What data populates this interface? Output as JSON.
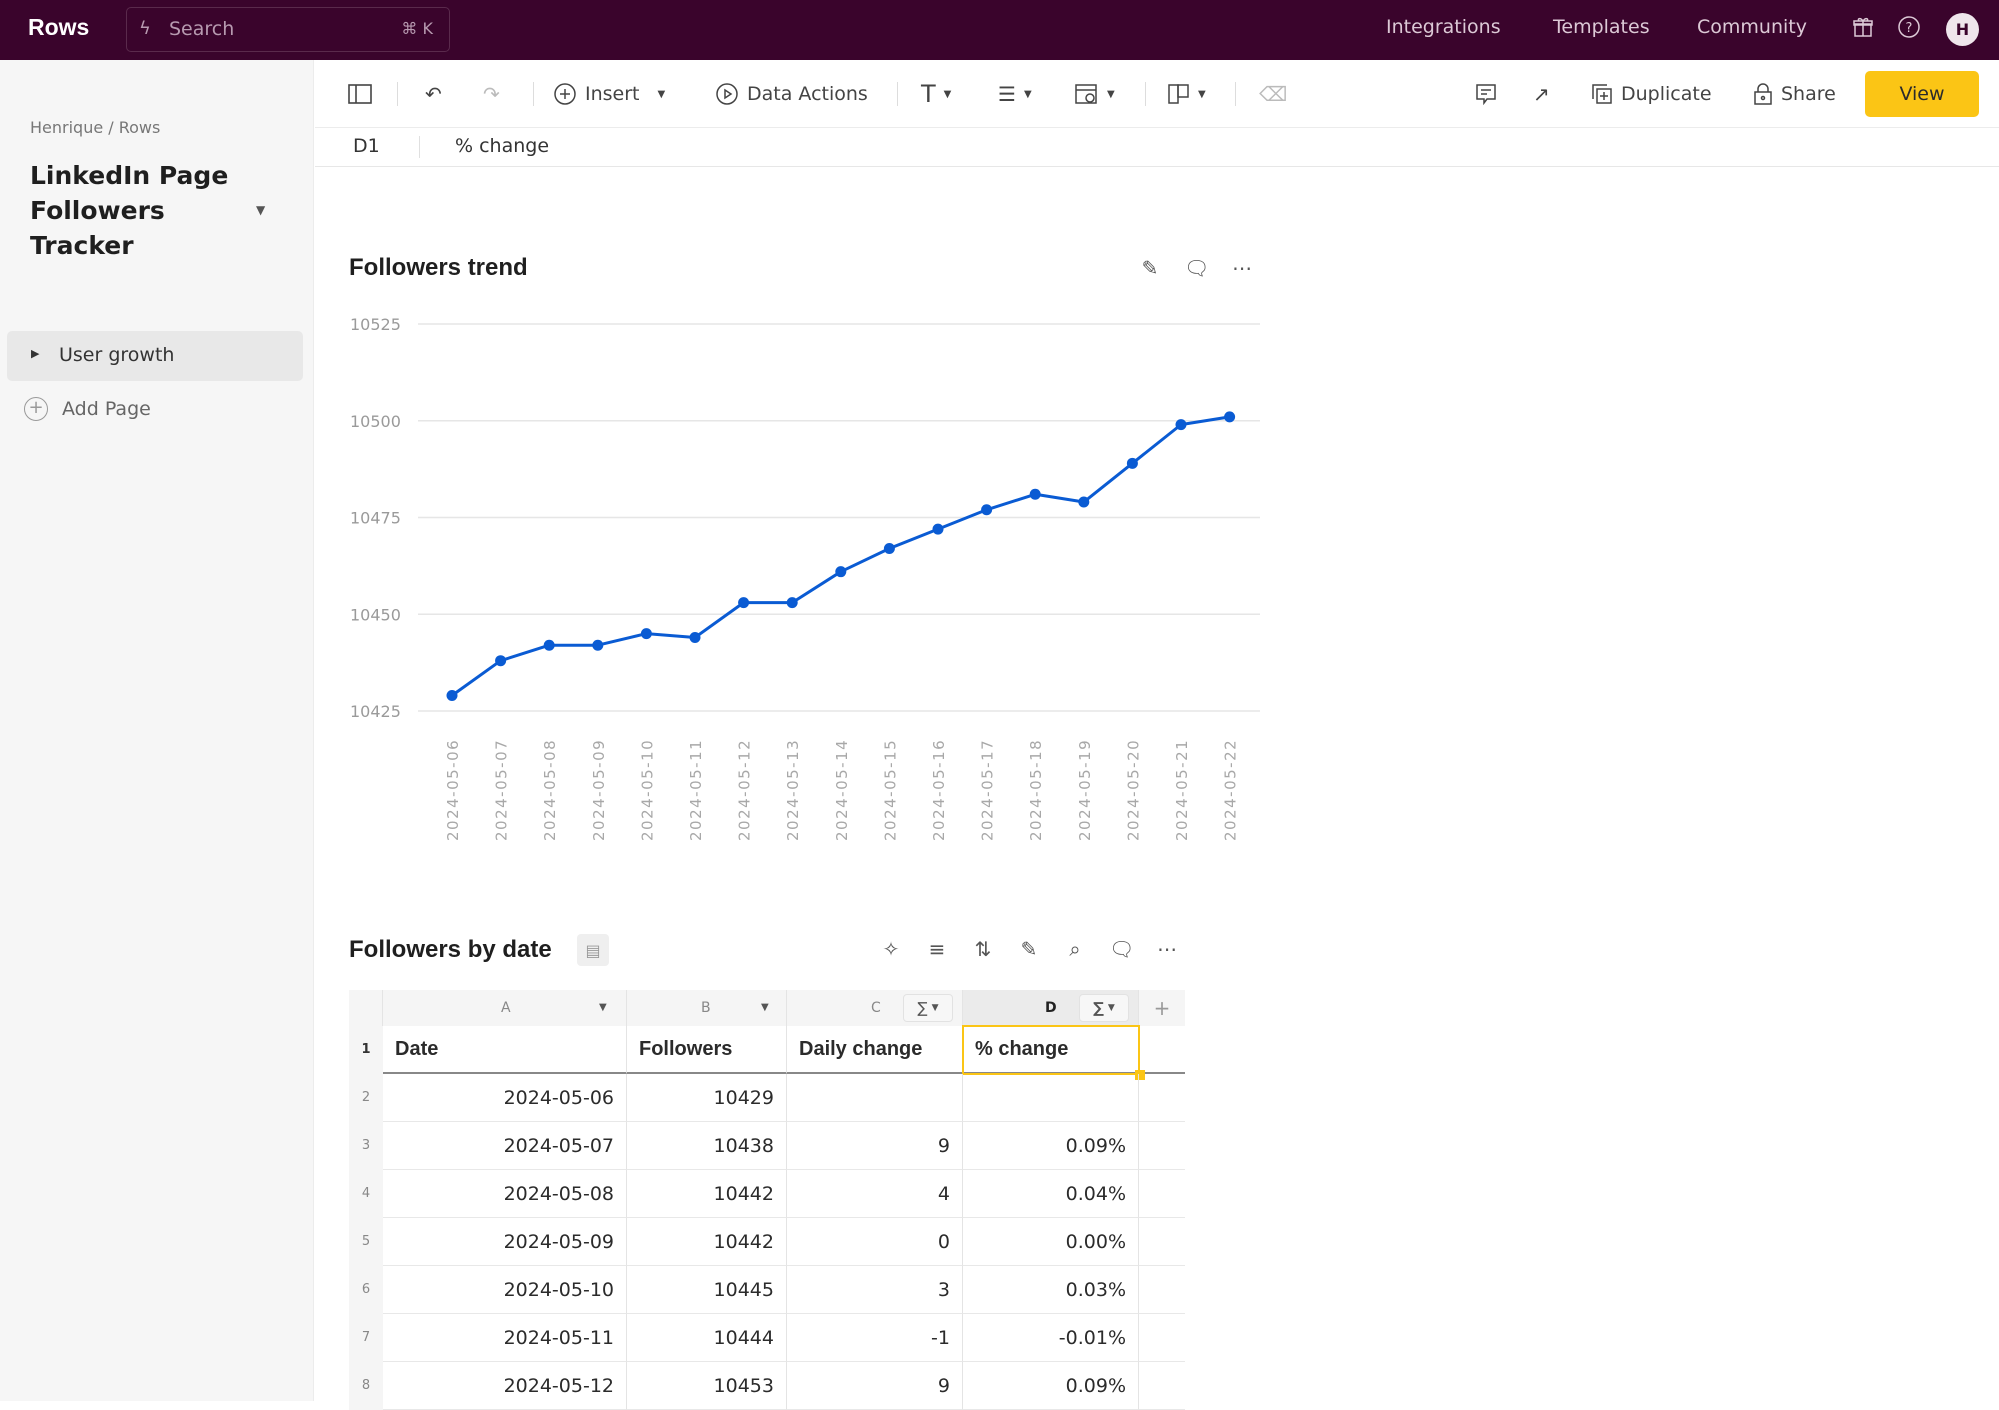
{
  "topbar": {
    "logo": "Rows",
    "search_placeholder": "Search",
    "search_shortcut": "⌘ K",
    "nav": [
      "Integrations",
      "Templates",
      "Community"
    ],
    "avatar_initial": "H"
  },
  "sidebar": {
    "breadcrumb": "Henrique / Rows",
    "doc_title": "LinkedIn Page Followers Tracker",
    "pages": [
      {
        "label": "User growth"
      }
    ],
    "add_page_label": "Add Page"
  },
  "toolbar": {
    "insert_label": "Insert",
    "data_actions_label": "Data Actions",
    "duplicate_label": "Duplicate",
    "share_label": "Share",
    "view_label": "View"
  },
  "formula_bar": {
    "cell_ref": "D1",
    "value": "% change"
  },
  "chart_card": {
    "title": "Followers trend"
  },
  "chart_data": {
    "type": "line",
    "title": "Followers trend",
    "xlabel": "",
    "ylabel": "",
    "x": [
      "2024-05-06",
      "2024-05-07",
      "2024-05-08",
      "2024-05-09",
      "2024-05-10",
      "2024-05-11",
      "2024-05-12",
      "2024-05-13",
      "2024-05-14",
      "2024-05-15",
      "2024-05-16",
      "2024-05-17",
      "2024-05-18",
      "2024-05-19",
      "2024-05-20",
      "2024-05-21",
      "2024-05-22"
    ],
    "series": [
      {
        "name": "Followers",
        "values": [
          10429,
          10438,
          10442,
          10442,
          10445,
          10444,
          10453,
          10453,
          10461,
          10467,
          10472,
          10477,
          10481,
          10479,
          10489,
          10499,
          10501
        ],
        "color": "#0a5bd3"
      }
    ],
    "yticks": [
      10425,
      10450,
      10475,
      10500,
      10525
    ],
    "ylim": [
      10425,
      10525
    ],
    "grid": true,
    "legend": "none"
  },
  "table_card": {
    "title": "Followers by date",
    "columns": [
      {
        "letter": "A",
        "header": "Date"
      },
      {
        "letter": "B",
        "header": "Followers"
      },
      {
        "letter": "C",
        "header": "Daily change"
      },
      {
        "letter": "D",
        "header": "% change"
      }
    ],
    "add_column": "+",
    "rows": [
      {
        "n": "2",
        "date": "2024-05-06",
        "followers": "10429",
        "change": "",
        "pct": ""
      },
      {
        "n": "3",
        "date": "2024-05-07",
        "followers": "10438",
        "change": "9",
        "pct": "0.09%"
      },
      {
        "n": "4",
        "date": "2024-05-08",
        "followers": "10442",
        "change": "4",
        "pct": "0.04%"
      },
      {
        "n": "5",
        "date": "2024-05-09",
        "followers": "10442",
        "change": "0",
        "pct": "0.00%"
      },
      {
        "n": "6",
        "date": "2024-05-10",
        "followers": "10445",
        "change": "3",
        "pct": "0.03%"
      },
      {
        "n": "7",
        "date": "2024-05-11",
        "followers": "10444",
        "change": "-1",
        "pct": "-0.01%"
      },
      {
        "n": "8",
        "date": "2024-05-12",
        "followers": "10453",
        "change": "9",
        "pct": "0.09%"
      }
    ],
    "header_row_num": "1",
    "sum_symbol": "∑"
  },
  "colors": {
    "brand_bar": "#3a042c",
    "accent_yellow": "#fbc515",
    "line_blue": "#0a5bd3"
  }
}
